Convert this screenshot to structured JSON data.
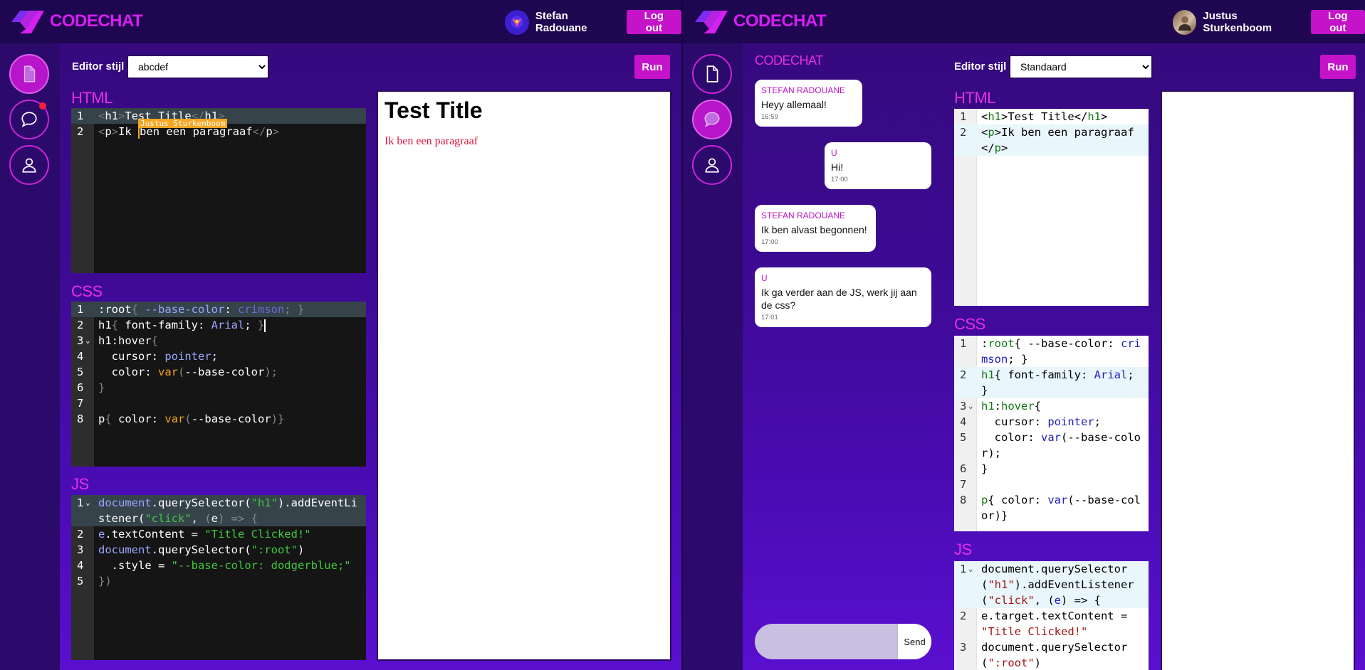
{
  "brand": {
    "name": "CODECHAT",
    "color": "#d61ff0"
  },
  "left": {
    "user": {
      "name": "Stefan Radouane",
      "logout_label": "Log out"
    },
    "editor_label": "Editor stijl",
    "editor_style": "abcdef",
    "run_label": "Run",
    "sections": {
      "html": "HTML",
      "css": "CSS",
      "js": "JS"
    },
    "html_lines": [
      {
        "n": "1",
        "hl": true,
        "parts": [
          [
            "&lt;",
            "#777"
          ],
          [
            "h1",
            "#fff"
          ],
          [
            "&gt;",
            "#777"
          ],
          [
            "Test Title",
            "#fff"
          ],
          [
            "&lt;/",
            "#777"
          ],
          [
            "h1",
            "#fff"
          ],
          [
            "&gt;",
            "#777"
          ]
        ]
      },
      {
        "n": "2",
        "hl": false,
        "parts": [
          [
            "&lt;",
            "#777"
          ],
          [
            "p",
            "#fff"
          ],
          [
            "&gt;",
            "#777"
          ],
          [
            "Ik ",
            "#fff"
          ],
          [
            "CARET",
            ""
          ],
          [
            "ben een paragraaf",
            "#fff"
          ],
          [
            "&lt;/",
            "#777"
          ],
          [
            "p",
            "#fff"
          ],
          [
            "&gt;",
            "#777"
          ]
        ]
      }
    ],
    "remote_cursor_name": "Justus Sturkenboom",
    "css_lines": [
      {
        "n": "1",
        "hl": true,
        "parts": [
          [
            ":root",
            "#fff"
          ],
          [
            "{ ",
            "#888"
          ],
          [
            "--base-color",
            "#9aa6ff"
          ],
          [
            ": ",
            "#fff"
          ],
          [
            "crimson",
            "#6b6bd6"
          ],
          [
            "; }",
            "#888"
          ]
        ]
      },
      {
        "n": "2",
        "hl": false,
        "parts": [
          [
            "h1",
            "#fff"
          ],
          [
            "{ ",
            "#888"
          ],
          [
            "font-family",
            "#fff"
          ],
          [
            ": ",
            "#fff"
          ],
          [
            "Arial",
            "#9aa6ff"
          ],
          [
            "; ",
            "#fff"
          ],
          [
            "}",
            "#888"
          ],
          [
            "CARET2",
            ""
          ]
        ]
      },
      {
        "n": "3",
        "hl": false,
        "fold": true,
        "parts": [
          [
            "h1:hover",
            "#fff"
          ],
          [
            "{",
            "#888"
          ]
        ]
      },
      {
        "n": "4",
        "hl": false,
        "parts": [
          [
            "  cursor",
            "#fff"
          ],
          [
            ": ",
            "#fff"
          ],
          [
            "pointer",
            "#9aa6ff"
          ],
          [
            ";",
            "#fff"
          ]
        ]
      },
      {
        "n": "5",
        "hl": false,
        "parts": [
          [
            "  color",
            "#fff"
          ],
          [
            ": ",
            "#fff"
          ],
          [
            "var",
            "#f0a020"
          ],
          [
            "(",
            "#888"
          ],
          [
            "--base-color",
            "#fff"
          ],
          [
            ");",
            "#888"
          ]
        ]
      },
      {
        "n": "6",
        "hl": false,
        "parts": [
          [
            "}",
            "#888"
          ]
        ]
      },
      {
        "n": "7",
        "hl": false,
        "parts": [
          [
            "",
            ""
          ]
        ]
      },
      {
        "n": "8",
        "hl": false,
        "parts": [
          [
            "p",
            "#fff"
          ],
          [
            "{ ",
            "#888"
          ],
          [
            "color",
            "#fff"
          ],
          [
            ": ",
            "#fff"
          ],
          [
            "var",
            "#f0a020"
          ],
          [
            "(",
            "#888"
          ],
          [
            "--base-color",
            "#fff"
          ],
          [
            ")}",
            "#888"
          ]
        ]
      }
    ],
    "js_lines": [
      {
        "n": "1",
        "hl": true,
        "fold": true,
        "parts": [
          [
            "document",
            "#9aa6ff"
          ],
          [
            ".querySelector(",
            "#fff"
          ],
          [
            "\"h1\"",
            "#3ec93e"
          ],
          [
            ").addEventListener(",
            "#fff"
          ],
          [
            "\"click\"",
            "#3ec93e"
          ],
          [
            ", ",
            "#fff"
          ],
          [
            "(",
            "#888"
          ],
          [
            "e",
            "#fff"
          ],
          [
            ") =&gt; ",
            "#888"
          ],
          [
            "{",
            "#888"
          ]
        ]
      },
      {
        "n": "2",
        "hl": false,
        "parts": [
          [
            "e",
            "#9aa6ff"
          ],
          [
            ".textContent = ",
            "#fff"
          ],
          [
            "\"Title Clicked!\"",
            "#3ec93e"
          ]
        ]
      },
      {
        "n": "3",
        "hl": false,
        "parts": [
          [
            "document",
            "#9aa6ff"
          ],
          [
            ".querySelector(",
            "#fff"
          ],
          [
            "\":root\"",
            "#3ec93e"
          ],
          [
            ")",
            "#fff"
          ]
        ]
      },
      {
        "n": "4",
        "hl": false,
        "parts": [
          [
            "  .style = ",
            "#fff"
          ],
          [
            "\"--base-color: dodgerblue;\"",
            "#3ec93e"
          ]
        ]
      },
      {
        "n": "5",
        "hl": false,
        "parts": [
          [
            "})",
            "#888"
          ]
        ]
      }
    ],
    "preview": {
      "title": "Test Title",
      "paragraph": "Ik ben een paragraaf",
      "paragraph_color": "#dc143c"
    }
  },
  "right": {
    "user": {
      "name": "Justus Sturkenboom",
      "logout_label": "Log out"
    },
    "chat_title": "CODECHAT",
    "messages": [
      {
        "from": "Stefan Radouane",
        "text": "Heyy allemaal!",
        "time": "16:59",
        "mine": false
      },
      {
        "from": "U",
        "text": "Hi!",
        "time": "17:00",
        "mine": true
      },
      {
        "from": "Stefan Radouane",
        "text": "Ik ben alvast begonnen!",
        "time": "17:00",
        "mine": false
      },
      {
        "from": "U",
        "text": "Ik ga verder aan de JS, werk jij aan de css?",
        "time": "17:01",
        "mine": true
      }
    ],
    "send_label": "Send",
    "editor_label": "Editor stijl",
    "editor_style": "Standaard",
    "run_label": "Run",
    "sections": {
      "html": "HTML",
      "css": "CSS",
      "js": "JS"
    },
    "html_lines": [
      {
        "n": "1",
        "hl": false,
        "parts": [
          [
            "&lt;",
            "#000"
          ],
          [
            "h1",
            "#117711"
          ],
          [
            "&gt;Test Title&lt;/",
            "#000"
          ],
          [
            "h1",
            "#117711"
          ],
          [
            "&gt;",
            "#000"
          ]
        ]
      },
      {
        "n": "2",
        "hl": true,
        "parts": [
          [
            "&lt;",
            "#000"
          ],
          [
            "p",
            "#117711"
          ],
          [
            "&gt;Ik ben een paragraaf&lt;/",
            "#000"
          ],
          [
            "p",
            "#117711"
          ],
          [
            "&gt;",
            "#000"
          ]
        ]
      }
    ],
    "css_lines": [
      {
        "n": "1",
        "hl": false,
        "parts": [
          [
            ":",
            "#000"
          ],
          [
            "root",
            "#117711"
          ],
          [
            "{ --base-color: ",
            "#000"
          ],
          [
            "crimson",
            "#1d1dc0"
          ],
          [
            "; }",
            "#000"
          ]
        ]
      },
      {
        "n": "2",
        "hl": true,
        "parts": [
          [
            "h1",
            "#117711"
          ],
          [
            "{ font-family: ",
            "#000"
          ],
          [
            "Arial",
            "#1d1dc0"
          ],
          [
            "; }",
            "#000"
          ]
        ]
      },
      {
        "n": "3",
        "hl": false,
        "fold": true,
        "parts": [
          [
            "h1",
            "#117711"
          ],
          [
            ":",
            "#000"
          ],
          [
            "hover",
            "#117711"
          ],
          [
            "{",
            "#000"
          ]
        ]
      },
      {
        "n": "4",
        "hl": false,
        "parts": [
          [
            "  cursor: ",
            "#000"
          ],
          [
            "pointer",
            "#1d1dc0"
          ],
          [
            ";",
            "#000"
          ]
        ]
      },
      {
        "n": "5",
        "hl": false,
        "parts": [
          [
            "  color: ",
            "#000"
          ],
          [
            "var",
            "#1d1dc0"
          ],
          [
            "(--base-color);",
            "#000"
          ]
        ]
      },
      {
        "n": "6",
        "hl": false,
        "parts": [
          [
            "}",
            "#000"
          ]
        ]
      },
      {
        "n": "7",
        "hl": false,
        "parts": [
          [
            "",
            ""
          ]
        ]
      },
      {
        "n": "8",
        "hl": false,
        "parts": [
          [
            "p",
            "#117711"
          ],
          [
            "{ color: ",
            "#000"
          ],
          [
            "var",
            "#1d1dc0"
          ],
          [
            "(--base-color)}",
            "#000"
          ]
        ]
      }
    ],
    "js_lines": [
      {
        "n": "1",
        "hl": true,
        "fold": true,
        "parts": [
          [
            "document.querySelector(",
            "#000"
          ],
          [
            "\"h1\"",
            "#a31515"
          ],
          [
            ").addEventListener(",
            "#000"
          ],
          [
            "\"click\"",
            "#a31515"
          ],
          [
            ", (",
            "#000"
          ],
          [
            "e",
            "#1d1dc0"
          ],
          [
            ") =&gt; {",
            "#000"
          ]
        ]
      },
      {
        "n": "2",
        "hl": false,
        "parts": [
          [
            "e.target.textContent = ",
            "#000"
          ],
          [
            "\"Title Clicked!\"",
            "#a31515"
          ]
        ]
      },
      {
        "n": "3",
        "hl": false,
        "parts": [
          [
            "document.querySelector(",
            "#000"
          ],
          [
            "\":root\"",
            "#a31515"
          ],
          [
            ")",
            "#000"
          ]
        ]
      }
    ]
  }
}
